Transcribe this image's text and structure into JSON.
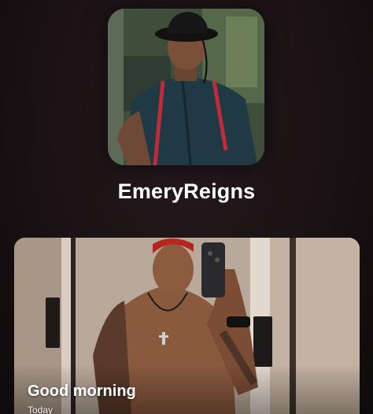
{
  "profile": {
    "username": "EmeryReigns",
    "avatar_alt": "profile photo"
  },
  "post": {
    "title": "Good morning",
    "time": "Today"
  }
}
